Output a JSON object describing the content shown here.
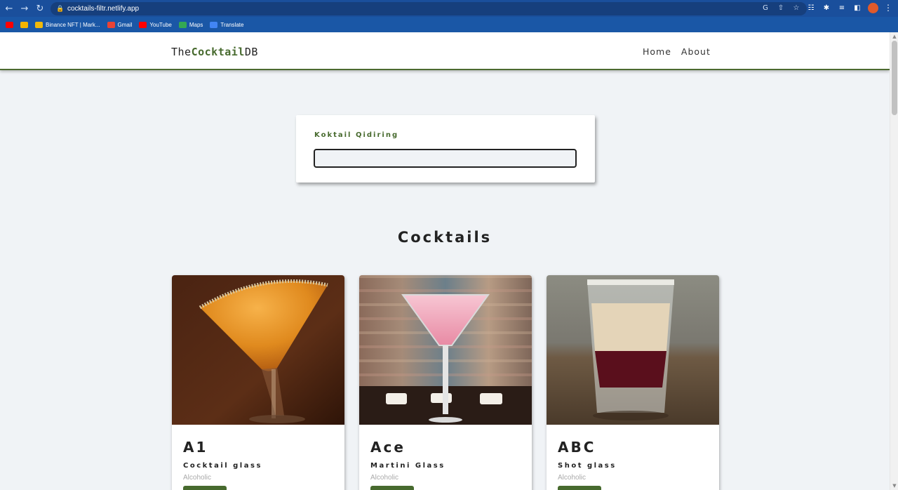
{
  "browser": {
    "url": "cocktails-filtr.netlify.app",
    "bookmarks": [
      {
        "label": "",
        "color": "#ff0000"
      },
      {
        "label": "",
        "color": "#f4b400"
      },
      {
        "label": "Binance NFT | Mark...",
        "color": "#f0b90b"
      },
      {
        "label": "Gmail",
        "color": "#ea4335"
      },
      {
        "label": "YouTube",
        "color": "#ff0000"
      },
      {
        "label": "Maps",
        "color": "#34a853"
      },
      {
        "label": "Translate",
        "color": "#4285f4"
      }
    ]
  },
  "navbar": {
    "logo_prefix": "The",
    "logo_accent": "Cocktail",
    "logo_suffix": "DB",
    "links": [
      "Home",
      "About"
    ]
  },
  "search": {
    "label": "Koktail Qidiring",
    "value": ""
  },
  "section_title": "Cocktails",
  "cocktails": [
    {
      "name": "A1",
      "glass": "Cocktail glass",
      "info": "Alcoholic",
      "image": "orange-martini-glass"
    },
    {
      "name": "Ace",
      "glass": "Martini Glass",
      "info": "Alcoholic",
      "image": "pink-martini-glass"
    },
    {
      "name": "ABC",
      "glass": "Shot glass",
      "info": "Alcoholic",
      "image": "layered-shot-glass"
    }
  ],
  "colors": {
    "accent": "#476a2e",
    "page_bg": "#f0f3f6",
    "chrome": "#1a4f9c"
  }
}
